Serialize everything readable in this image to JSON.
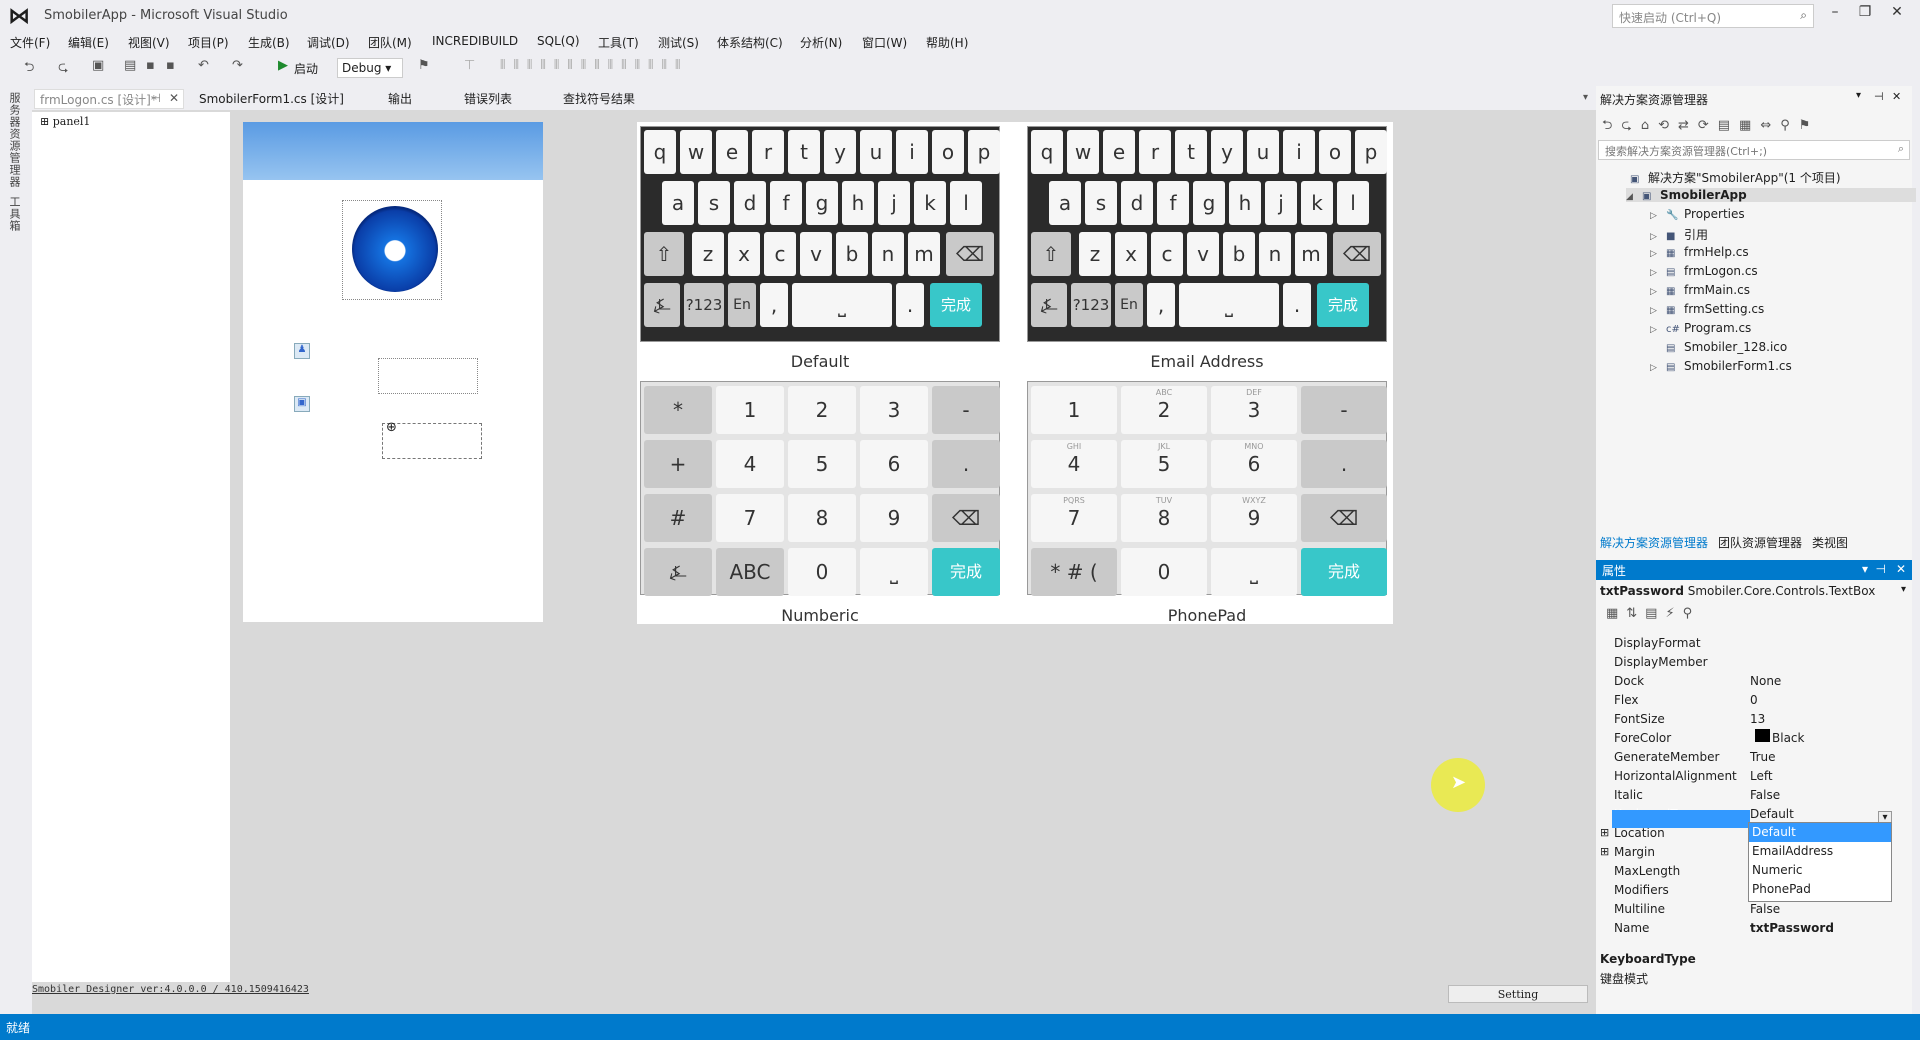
{
  "window": {
    "title": "SmobilerApp - Microsoft Visual Studio",
    "quick_launch_placeholder": "快速启动 (Ctrl+Q)"
  },
  "menu": [
    "文件(F)",
    "编辑(E)",
    "视图(V)",
    "项目(P)",
    "生成(B)",
    "调试(D)",
    "团队(M)",
    "INCREDIBUILD",
    "SQL(Q)",
    "工具(T)",
    "测试(S)",
    "体系结构(C)",
    "分析(N)",
    "窗口(W)",
    "帮助(H)"
  ],
  "toolbar": {
    "start_label": "启动",
    "config": "Debug"
  },
  "left_tabs": [
    "服务器资源管理器",
    "工具箱"
  ],
  "doc_tabs": [
    {
      "label": "frmLogon.cs [设计]*"
    },
    {
      "label": "SmobilerForm1.cs [设计]"
    },
    {
      "label": "输出"
    },
    {
      "label": "错误列表"
    },
    {
      "label": "查找符号结果"
    }
  ],
  "designer": {
    "tree_node": "panel1",
    "version_text": "Smobiler Designer ver:4.0.0.0 / 410.1509416423",
    "setting_label": "Setting"
  },
  "keyboards": {
    "default_caption": "Default",
    "email_caption": "Email Address",
    "numeric_caption": "Numberic",
    "phonepad_caption": "PhonePad",
    "row1": [
      "q",
      "w",
      "e",
      "r",
      "t",
      "y",
      "u",
      "i",
      "o",
      "p"
    ],
    "row2": [
      "a",
      "s",
      "d",
      "f",
      "g",
      "h",
      "j",
      "k",
      "l"
    ],
    "row3": [
      "z",
      "x",
      "c",
      "v",
      "b",
      "n",
      "m"
    ],
    "k123": "?123",
    "ken": "En",
    "kcomma": ",",
    "kdot": ".",
    "kdone": "完成",
    "numeric": [
      [
        "*",
        "1",
        "2",
        "3",
        "-"
      ],
      [
        "+",
        "4",
        "5",
        "6",
        "."
      ],
      [
        "#",
        "7",
        "8",
        "9",
        ""
      ],
      [
        "",
        "ABC",
        "0",
        "",
        ""
      ]
    ],
    "phone": [
      [
        "1",
        "2",
        "3",
        "-"
      ],
      [
        "4",
        "5",
        "6",
        "."
      ],
      [
        "7",
        "8",
        "9",
        ""
      ],
      [
        "* # (",
        "0",
        "",
        ""
      ]
    ],
    "phone_sub": [
      "",
      "ABC",
      "DEF",
      "",
      "GHI",
      "JKL",
      "MNO",
      "",
      "PQRS",
      "TUV",
      "WXYZ",
      ""
    ]
  },
  "solution": {
    "title": "解决方案资源管理器",
    "search_placeholder": "搜索解决方案资源管理器(Ctrl+;)",
    "items": [
      "解决方案\"SmobilerApp\"(1 个项目)",
      "SmobilerApp",
      "Properties",
      "引用",
      "frmHelp.cs",
      "frmLogon.cs",
      "frmMain.cs",
      "frmSetting.cs",
      "Program.cs",
      "Smobiler_128.ico",
      "SmobilerForm1.cs"
    ],
    "bottom_tabs": [
      "解决方案资源管理器",
      "团队资源管理器",
      "类视图"
    ]
  },
  "properties": {
    "title": "属性",
    "object_name": "txtPassword",
    "object_type": "Smobiler.Core.Controls.TextBox",
    "rows": [
      {
        "n": "DisplayFormat",
        "v": ""
      },
      {
        "n": "DisplayMember",
        "v": ""
      },
      {
        "n": "Dock",
        "v": "None"
      },
      {
        "n": "Flex",
        "v": "0"
      },
      {
        "n": "FontSize",
        "v": "13"
      },
      {
        "n": "ForeColor",
        "v": "Black"
      },
      {
        "n": "GenerateMember",
        "v": "True"
      },
      {
        "n": "HorizontalAlignment",
        "v": "Left"
      },
      {
        "n": "Italic",
        "v": "False"
      },
      {
        "n": "KeyboardType",
        "v": "Default"
      },
      {
        "n": "Location",
        "v": ""
      },
      {
        "n": "Margin",
        "v": ""
      },
      {
        "n": "MaxLength",
        "v": ""
      },
      {
        "n": "Modifiers",
        "v": ""
      },
      {
        "n": "Multiline",
        "v": "False"
      },
      {
        "n": "Name",
        "v": "txtPassword"
      }
    ],
    "dropdown": [
      "Default",
      "EmailAddress",
      "Numeric",
      "PhonePad"
    ],
    "desc_title": "KeyboardType",
    "desc_text": "键盘模式"
  },
  "status": {
    "text": "就绪"
  },
  "colors": {
    "accent": "#007acc",
    "done_key": "#38c7c9"
  }
}
